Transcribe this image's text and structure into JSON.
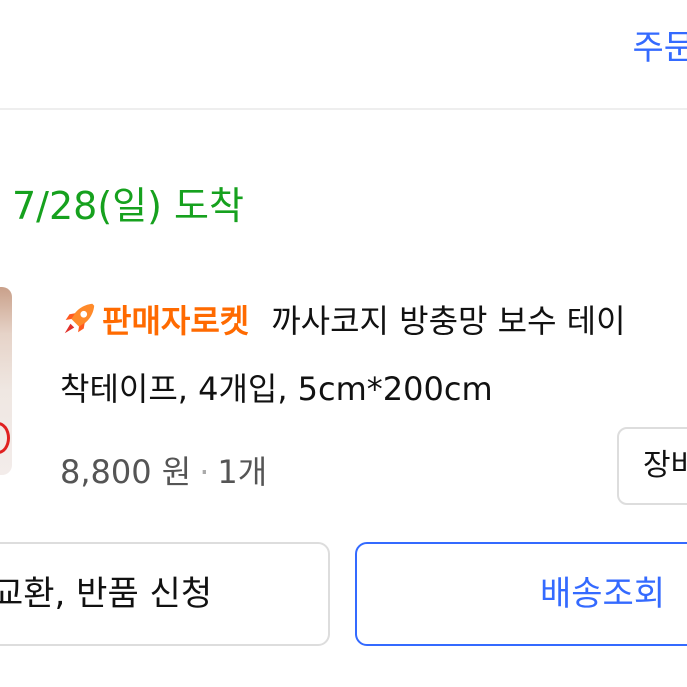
{
  "header": {
    "order_link_label": "주문"
  },
  "delivery": {
    "arrival_text": "7/28(일) 도착"
  },
  "product": {
    "badge_label": "판매자로켓",
    "title_line1": "까사코지 방충망 보수 테이",
    "title_line2": "착테이프, 4개입, 5cm*200cm",
    "price": "8,800 원",
    "separator": "·",
    "quantity": "1개",
    "cart_button_label": "장바",
    "rocket_icon": "rocket-icon",
    "badge_color": "#ff6a00"
  },
  "actions": {
    "return_label": "교환, 반품 신청",
    "track_label": "배송조회"
  },
  "colors": {
    "accent_blue": "#346aff",
    "arrival_green": "#16a11e"
  }
}
